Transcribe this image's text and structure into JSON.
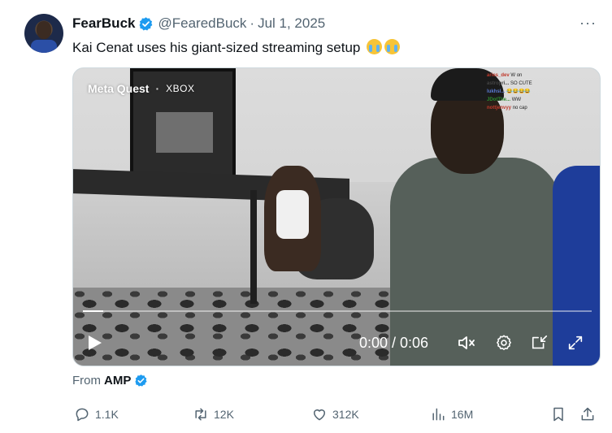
{
  "tweet": {
    "display_name": "FearBuck",
    "handle": "@FearedBuck",
    "separator": "·",
    "date": "Jul 1, 2025",
    "more_label": "···",
    "text": "Kai Cenat uses his giant-sized streaming setup",
    "emoji": "loudly-crying-face"
  },
  "media": {
    "watermark_left": "Meta Quest",
    "watermark_sep": "·",
    "watermark_right": "XBOX",
    "chat": [
      {
        "user": "aries_dev",
        "msg": "W on"
      },
      {
        "user": "astropri...",
        "msg": "SO CUTE"
      },
      {
        "user": "lukhsl...",
        "msg": "😂😂😂😂"
      },
      {
        "user": "JDotThe...",
        "msg": "WW"
      },
      {
        "user": "nottjenvyy",
        "msg": "no cap"
      }
    ],
    "time_display": "0:00 / 0:06",
    "progress": 0.04
  },
  "attribution": {
    "prefix": "From",
    "source": "AMP"
  },
  "actions": {
    "replies": "1.1K",
    "reposts": "12K",
    "likes": "312K",
    "views": "16M"
  },
  "colors": {
    "verified": "#1d9bf0",
    "muted_text": "#536471",
    "primary_text": "#0f1419"
  }
}
